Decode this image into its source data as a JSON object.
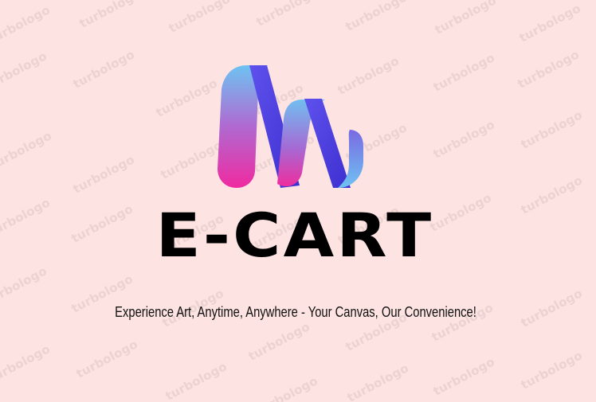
{
  "brand": {
    "name": "E-CART",
    "tagline": "Experience Art, Anytime, Anywhere - Your Canvas, Our Convenience!"
  },
  "watermark": {
    "text": "turbologo"
  },
  "colors": {
    "background": "#fde3e1",
    "gradient_blue": "#6ec3f2",
    "gradient_violet": "#4c39d8",
    "gradient_pink": "#f02aa0"
  },
  "icons": {
    "logo": "wave-ribbon-icon"
  }
}
